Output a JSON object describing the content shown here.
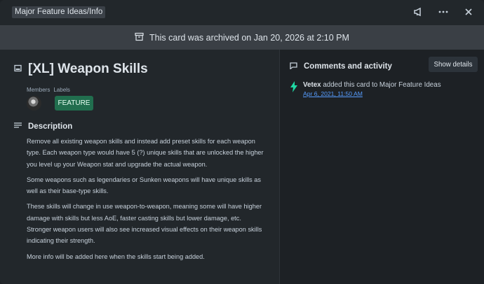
{
  "header": {
    "breadcrumb": "Major Feature Ideas/Info"
  },
  "banner": {
    "text": "This card was archived on Jan 20, 2026 at 2:10 PM"
  },
  "card": {
    "title": "[XL] Weapon Skills",
    "members_label": "Members",
    "labels_label": "Labels",
    "label_badge": "FEATURE",
    "label_color": "#216e4e",
    "description_heading": "Description",
    "description": [
      "Remove all existing weapon skills and instead add preset skills for each weapon type. Each weapon type would have 5 (?) unique skills that are unlocked the higher you level up your Weapon stat and upgrade the actual weapon.",
      "Some weapons such as legendaries or Sunken weapons will have unique skills as well as their base-type skills.",
      "These skills will change in use weapon-to-weapon, meaning some will have higher damage with skills but less AoE, faster casting skills but lower damage, etc. Stronger weapon users will also see increased visual effects on their weapon skills indicating their strength.",
      "More info will be added here when the skills start being added."
    ]
  },
  "activity": {
    "heading": "Comments and activity",
    "show_details": "Show details",
    "items": [
      {
        "user": "Vetex",
        "action": " added this card to Major Feature Ideas",
        "time": "Apr 6, 2021, 11:50 AM",
        "icon": "lightning-icon"
      }
    ]
  },
  "icons": {
    "top_right": [
      "megaphone-icon",
      "more-icon",
      "close-icon"
    ],
    "banner": "archive-icon",
    "title": "card-icon",
    "description": "description-icon",
    "activity": "activity-icon"
  }
}
